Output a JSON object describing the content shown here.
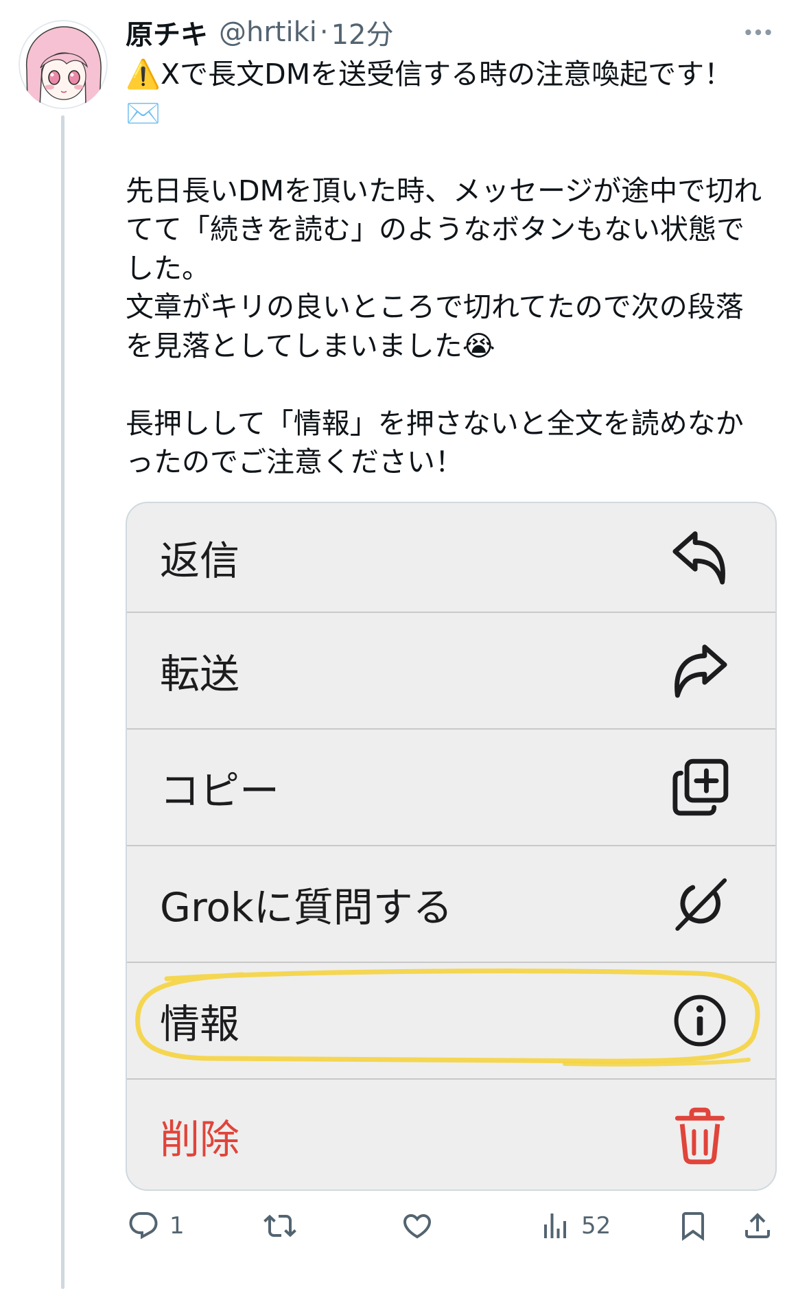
{
  "author": {
    "name": "原チキ",
    "handle": "@hrtiki",
    "separator": "·",
    "time": "12分"
  },
  "tweet": {
    "paragraphs": [
      {
        "lines": [
          "⚠️Xで長文DMを送受信する時の注意喚起です！",
          "✉️"
        ]
      },
      {
        "lines": [
          "先日長いDMを頂いた時、メッセージが途中で切れ",
          "てて「続きを読む」のようなボタンもない状態で",
          "した。",
          "文章がキリの良いところで切れてたので次の段落",
          "を見落としてしまいました😭"
        ]
      },
      {
        "lines": [
          "長押しして「情報」を押さないと全文を読めなか",
          "ったのでご注意ください！"
        ]
      }
    ]
  },
  "media": {
    "menu": {
      "items": [
        {
          "label": "返信",
          "icon": "reply-arrow-icon"
        },
        {
          "label": "転送",
          "icon": "forward-arrow-icon"
        },
        {
          "label": "コピー",
          "icon": "copy-plus-icon"
        },
        {
          "label": "Grokに質問する",
          "icon": "grok-icon"
        },
        {
          "label": "情報",
          "icon": "info-icon",
          "highlighted": true
        },
        {
          "label": "削除",
          "icon": "trash-icon",
          "destructive": true
        }
      ]
    }
  },
  "actions": {
    "reply": {
      "icon": "reply-bubble-icon",
      "count": "1"
    },
    "retweet": {
      "icon": "retweet-icon"
    },
    "like": {
      "icon": "heart-icon"
    },
    "views": {
      "icon": "views-chart-icon",
      "count": "52"
    },
    "bookmark": {
      "icon": "bookmark-icon"
    },
    "share": {
      "icon": "share-icon"
    }
  },
  "colors": {
    "text": "#0f1419",
    "secondary_text": "#536471",
    "more_dots": "#8b98a5",
    "thread_line": "#cfd9de",
    "media_border": "#cfd9de",
    "menu_background": "#eeeeee",
    "menu_divider": "#c8c8c8",
    "menu_text": "#1c1c1e",
    "destructive": "#e0443a",
    "highlight": "#f5d33f"
  }
}
